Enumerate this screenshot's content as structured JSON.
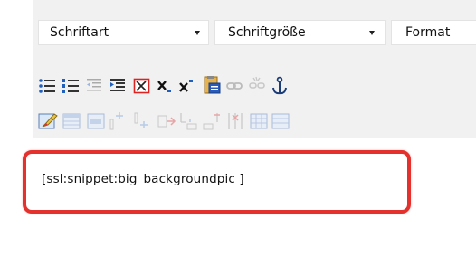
{
  "toolbar": {
    "dropdowns": [
      {
        "label": "Schriftart"
      },
      {
        "label": "Schriftgröße"
      },
      {
        "label": "Format"
      }
    ],
    "row1_icons": [
      "unordered-list-icon",
      "ordered-list-icon",
      "outdent-icon",
      "indent-icon",
      "insert-template-icon",
      "subscript-icon",
      "superscript-icon",
      "paste-from-word-icon",
      "link-icon",
      "unlink-icon",
      "anchor-icon"
    ],
    "row2_icons": [
      "edit-code-icon",
      "table-icon",
      "table-properties-icon",
      "row-above-icon",
      "row-below-icon",
      "row-delete-icon",
      "column-before-icon",
      "column-after-icon",
      "column-delete-icon",
      "merge-cells-icon",
      "split-cells-icon"
    ]
  },
  "editor": {
    "content": "[ssl:snippet:big_backgroundpic ]"
  },
  "colors": {
    "highlight": "#e4312d",
    "toolbar_bg": "#f1f1f1"
  }
}
